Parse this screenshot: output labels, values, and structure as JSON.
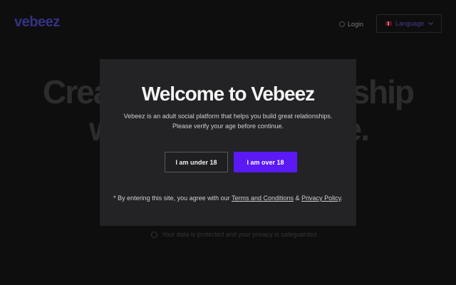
{
  "header": {
    "logo": "vebeez",
    "login_label": "Login",
    "language_label": "Language"
  },
  "hero": {
    "line1_left": "Crea",
    "line1_right": "ship",
    "line2_left": "w",
    "line2_right": "e."
  },
  "footer": {
    "privacy_text": "Your data is protected and your privacy is safeguarded."
  },
  "modal": {
    "title": "Welcome to Vebeez",
    "description_line1": "Vebeez is an adult social platform that helps you build great relationships.",
    "description_line2": "Please verify your age before continue.",
    "under_button": "I am under 18",
    "over_button": "I am over 18",
    "note_prefix": "* By entering this site, you agree with our ",
    "terms_link": "Terms and Conditions",
    "note_and": " & ",
    "privacy_link": "Privacy Policy",
    "note_suffix": "."
  },
  "colors": {
    "brand": "#5b5cf0",
    "primary_button": "#5a19f5",
    "modal_bg": "#232325"
  }
}
